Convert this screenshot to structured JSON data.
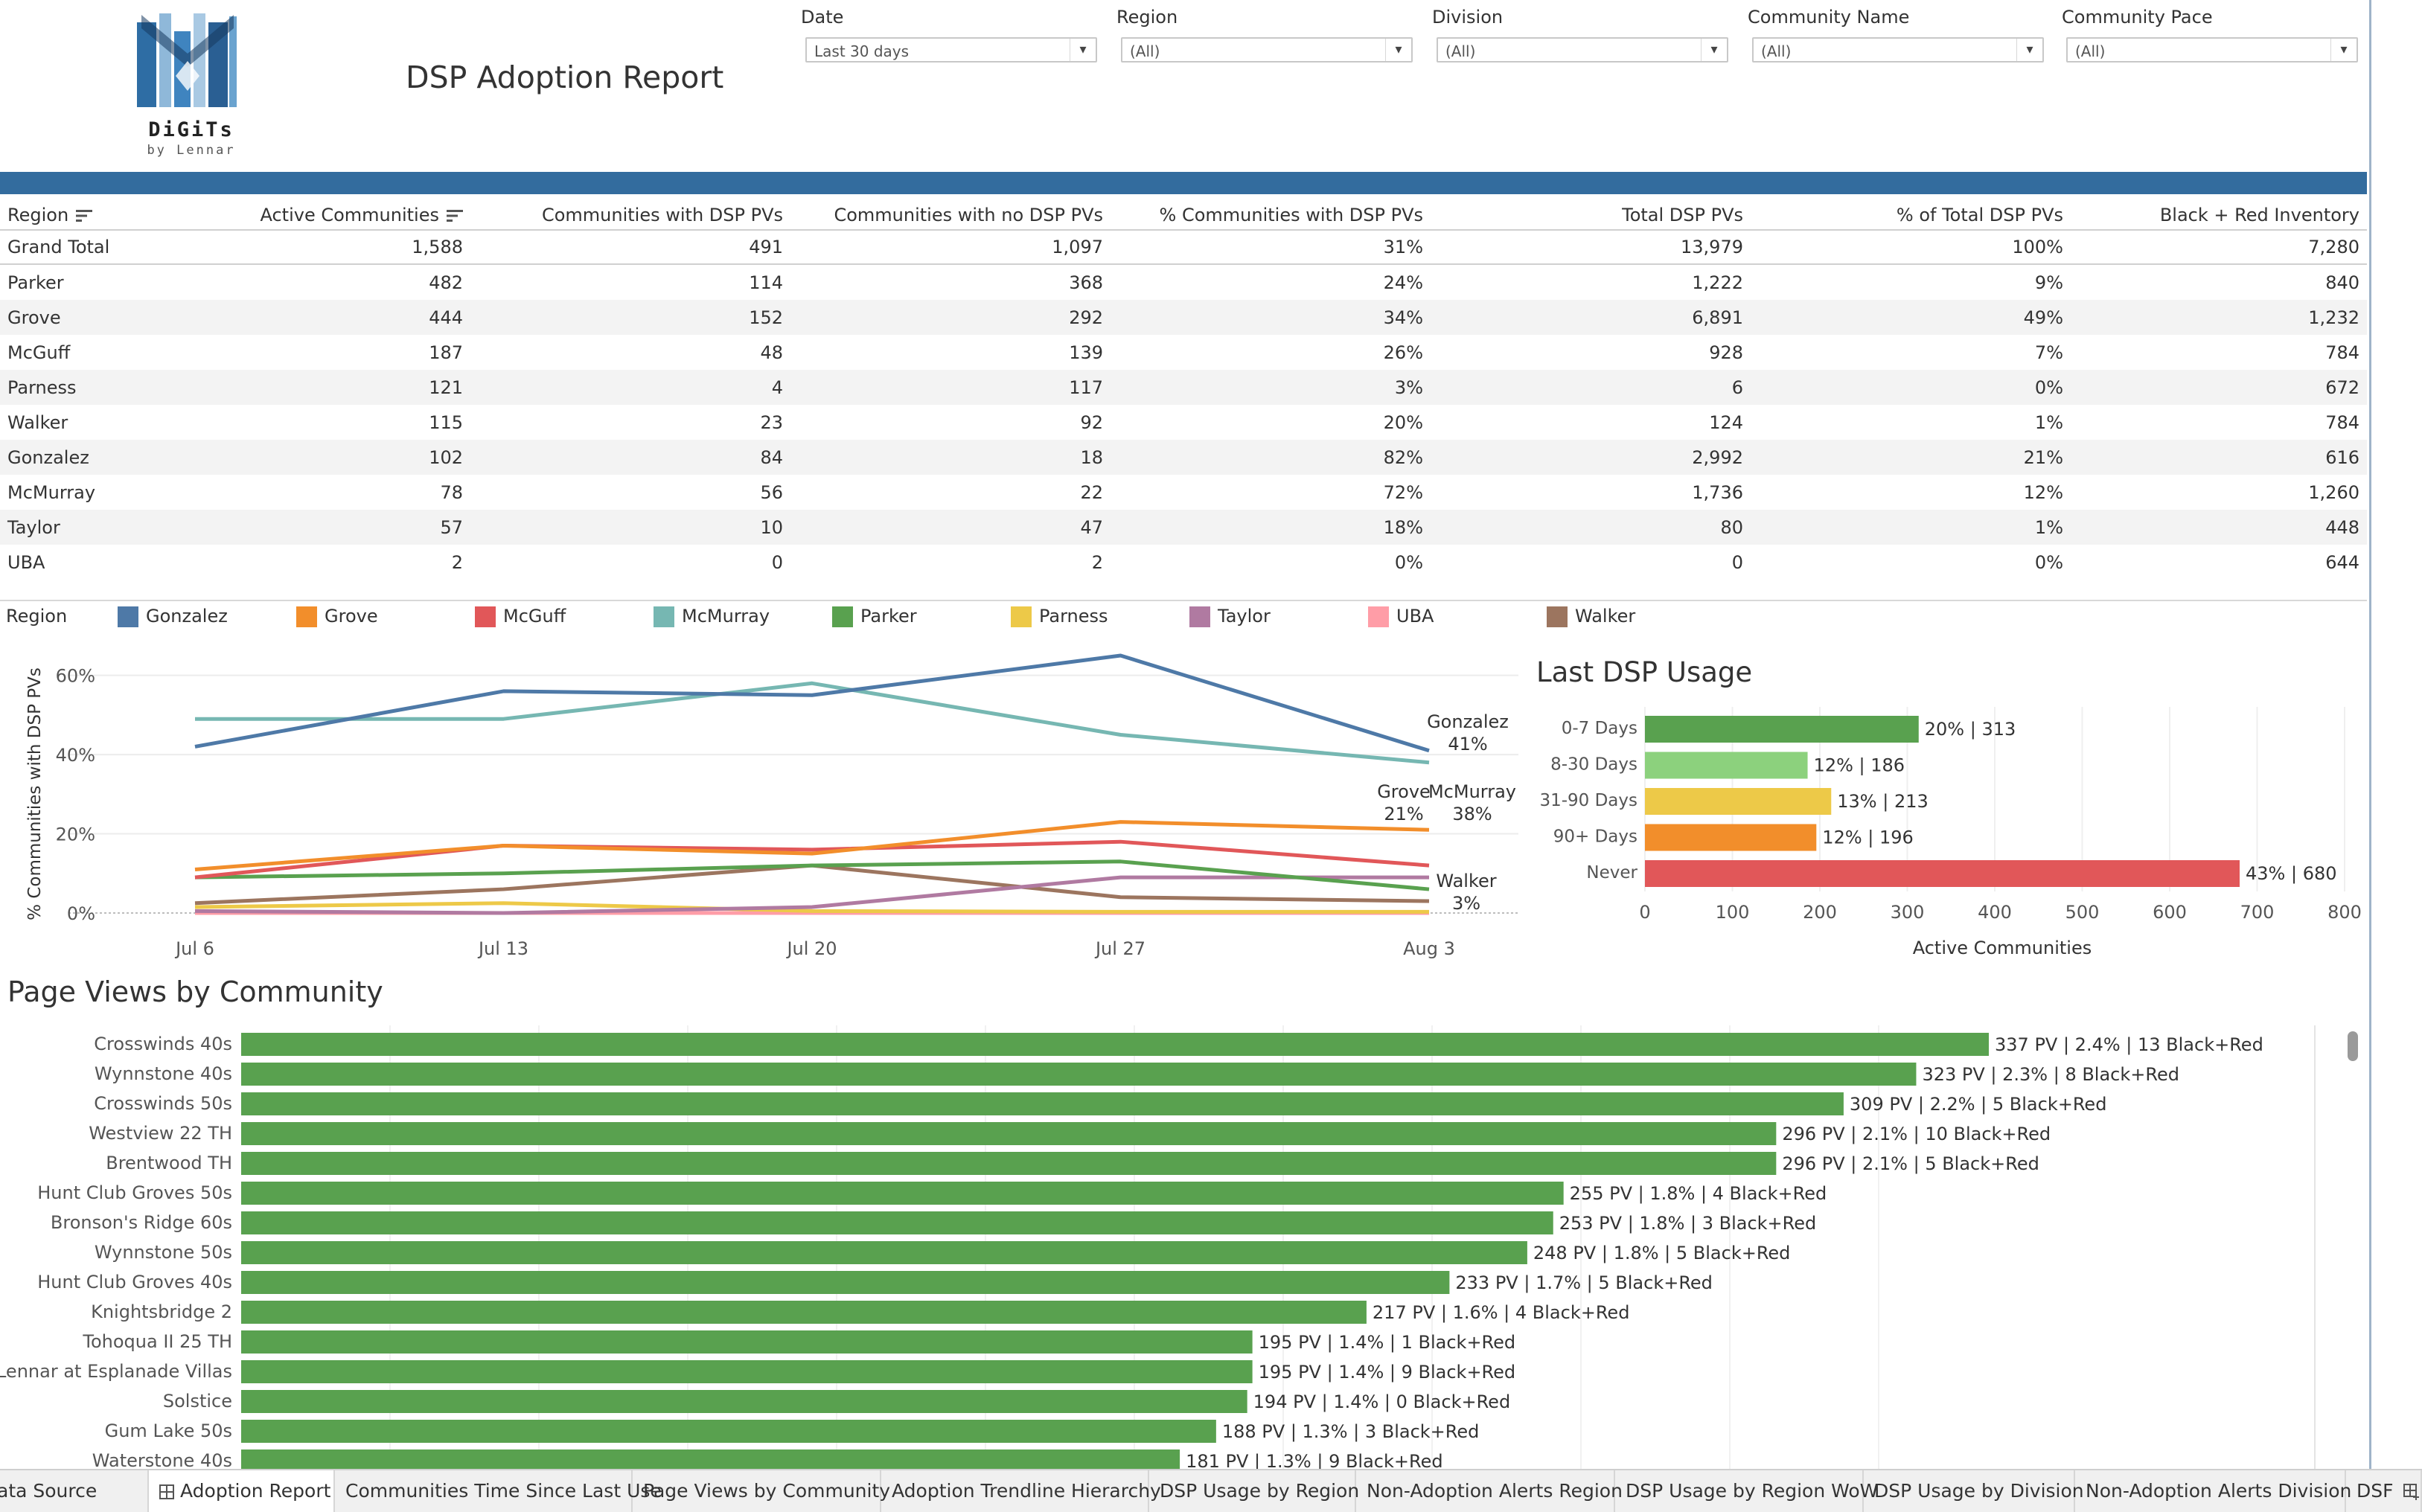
{
  "header": {
    "logo_text": "DiGiTs",
    "logo_subtext": "by Lennar",
    "title": "DSP Adoption Report"
  },
  "filters": [
    {
      "label": "Date",
      "value": "Last 30 days"
    },
    {
      "label": "Region",
      "value": "(All)"
    },
    {
      "label": "Division",
      "value": "(All)"
    },
    {
      "label": "Community Name",
      "value": "(All)"
    },
    {
      "label": "Community Pace",
      "value": "(All)"
    }
  ],
  "table": {
    "columns": [
      "Region",
      "Active Communities",
      "Communities with DSP PVs",
      "Communities with no DSP PVs",
      "% Communities with DSP PVs",
      "Total DSP PVs",
      "% of Total DSP PVs",
      "Black + Red Inventory"
    ],
    "rows": [
      [
        "Grand Total",
        "1,588",
        "491",
        "1,097",
        "31%",
        "13,979",
        "100%",
        "7,280"
      ],
      [
        "Parker",
        "482",
        "114",
        "368",
        "24%",
        "1,222",
        "9%",
        "840"
      ],
      [
        "Grove",
        "444",
        "152",
        "292",
        "34%",
        "6,891",
        "49%",
        "1,232"
      ],
      [
        "McGuff",
        "187",
        "48",
        "139",
        "26%",
        "928",
        "7%",
        "784"
      ],
      [
        "Parness",
        "121",
        "4",
        "117",
        "3%",
        "6",
        "0%",
        "672"
      ],
      [
        "Walker",
        "115",
        "23",
        "92",
        "20%",
        "124",
        "1%",
        "784"
      ],
      [
        "Gonzalez",
        "102",
        "84",
        "18",
        "82%",
        "2,992",
        "21%",
        "616"
      ],
      [
        "McMurray",
        "78",
        "56",
        "22",
        "72%",
        "1,736",
        "12%",
        "1,260"
      ],
      [
        "Taylor",
        "57",
        "10",
        "47",
        "18%",
        "80",
        "1%",
        "448"
      ],
      [
        "UBA",
        "2",
        "0",
        "2",
        "0%",
        "0",
        "0%",
        "644"
      ]
    ]
  },
  "legend": {
    "title": "Region",
    "items": [
      {
        "name": "Gonzalez",
        "color": "#4e79a7"
      },
      {
        "name": "Grove",
        "color": "#f28e2b"
      },
      {
        "name": "McGuff",
        "color": "#e15759"
      },
      {
        "name": "McMurray",
        "color": "#76b7b2"
      },
      {
        "name": "Parker",
        "color": "#59a14f"
      },
      {
        "name": "Parness",
        "color": "#edc948"
      },
      {
        "name": "Taylor",
        "color": "#b07aa1"
      },
      {
        "name": "UBA",
        "color": "#ff9da7"
      },
      {
        "name": "Walker",
        "color": "#9c755f"
      }
    ]
  },
  "chart_data": [
    {
      "type": "line",
      "title": "",
      "ylabel": "% Communities with DSP PVs",
      "xlabel": "",
      "x": [
        "Jul 6",
        "Jul 13",
        "Jul 20",
        "Jul 27",
        "Aug 3"
      ],
      "ylim": [
        0,
        65
      ],
      "yticks": [
        "0%",
        "20%",
        "40%",
        "60%"
      ],
      "grid": true,
      "series": [
        {
          "name": "Gonzalez",
          "color": "#4e79a7",
          "values": [
            42,
            56,
            55,
            65,
            41
          ],
          "end_label": "41%"
        },
        {
          "name": "McMurray",
          "color": "#76b7b2",
          "values": [
            49,
            49,
            58,
            45,
            38
          ],
          "end_label": "38%"
        },
        {
          "name": "Grove",
          "color": "#f28e2b",
          "values": [
            11,
            17,
            15,
            23,
            21
          ],
          "end_label": "21%"
        },
        {
          "name": "McGuff",
          "color": "#e15759",
          "values": [
            9,
            17,
            16,
            18,
            12
          ]
        },
        {
          "name": "Parker",
          "color": "#59a14f",
          "values": [
            9,
            10,
            12,
            13,
            6
          ]
        },
        {
          "name": "Taylor",
          "color": "#b07aa1",
          "values": [
            0.5,
            0,
            1.5,
            9,
            9
          ]
        },
        {
          "name": "Walker",
          "color": "#9c755f",
          "values": [
            2.5,
            6,
            12,
            4,
            3
          ],
          "end_label": "3%"
        },
        {
          "name": "Parness",
          "color": "#edc948",
          "values": [
            1.5,
            2.5,
            0.5,
            0.3,
            0.3
          ]
        },
        {
          "name": "UBA",
          "color": "#ff9da7",
          "values": [
            0,
            0,
            0,
            0,
            0
          ]
        }
      ]
    },
    {
      "type": "bar",
      "title": "Last DSP Usage",
      "xlabel": "Active Communities",
      "ylabel": "",
      "categories": [
        "0-7 Days",
        "8-30 Days",
        "31-90 Days",
        "90+ Days",
        "Never"
      ],
      "values": [
        313,
        186,
        213,
        196,
        680
      ],
      "labels": [
        "20% | 313",
        "12% | 186",
        "13% | 213",
        "12% | 196",
        "43% | 680"
      ],
      "colors": [
        "#59a14f",
        "#8cd17d",
        "#edc948",
        "#f28e2b",
        "#e15759"
      ],
      "xlim": [
        0,
        800
      ],
      "xticks": [
        "0",
        "100",
        "200",
        "300",
        "400",
        "500",
        "600",
        "700",
        "800"
      ]
    },
    {
      "type": "bar",
      "title": "Page Views by Community",
      "xlabel": "",
      "ylabel": "",
      "color": "#59a14f",
      "categories": [
        "Crosswinds 40s",
        "Wynnstone 40s",
        "Crosswinds 50s",
        "Westview 22 TH",
        "Brentwood TH",
        "Hunt Club Groves 50s",
        "Bronson's Ridge 60s",
        "Wynnstone 50s",
        "Hunt Club Groves 40s",
        "Knightsbridge 2",
        "Tohoqua II 25 TH",
        "Lennar at Esplanade Villas",
        "Solstice",
        "Gum Lake 50s",
        "Waterstone 40s"
      ],
      "values": [
        337,
        323,
        309,
        296,
        296,
        255,
        253,
        248,
        233,
        217,
        195,
        195,
        194,
        188,
        181
      ],
      "labels": [
        "337 PV | 2.4% | 13 Black+Red",
        "323 PV | 2.3% | 8 Black+Red",
        "309 PV | 2.2% | 5 Black+Red",
        "296 PV | 2.1% | 10 Black+Red",
        "296 PV | 2.1% | 5 Black+Red",
        "255 PV | 1.8% | 4 Black+Red",
        "253 PV | 1.8% | 3 Black+Red",
        "248 PV | 1.8% | 5 Black+Red",
        "233 PV | 1.7% | 5 Black+Red",
        "217 PV | 1.6% | 4 Black+Red",
        "195 PV | 1.4% | 1 Black+Red",
        "195 PV | 1.4% | 9 Black+Red",
        "194 PV | 1.4% | 0 Black+Red",
        "188 PV | 1.3% | 3 Black+Red",
        "181 PV | 1.3% | 9 Black+Red"
      ]
    }
  ],
  "tabs": [
    {
      "label": "ata Source",
      "active": false
    },
    {
      "label": "Adoption Report",
      "active": true
    },
    {
      "label": "Communities Time Since Last Use",
      "active": false
    },
    {
      "label": "Page Views by Community",
      "active": false
    },
    {
      "label": "Adoption Trendline Hierarchy",
      "active": false
    },
    {
      "label": "DSP Usage by Region",
      "active": false
    },
    {
      "label": "Non-Adoption Alerts Region",
      "active": false
    },
    {
      "label": "DSP Usage by Region WoW",
      "active": false
    },
    {
      "label": "DSP Usage by Division",
      "active": false
    },
    {
      "label": "Non-Adoption Alerts Division",
      "active": false
    },
    {
      "label": "DSF",
      "active": false
    }
  ]
}
